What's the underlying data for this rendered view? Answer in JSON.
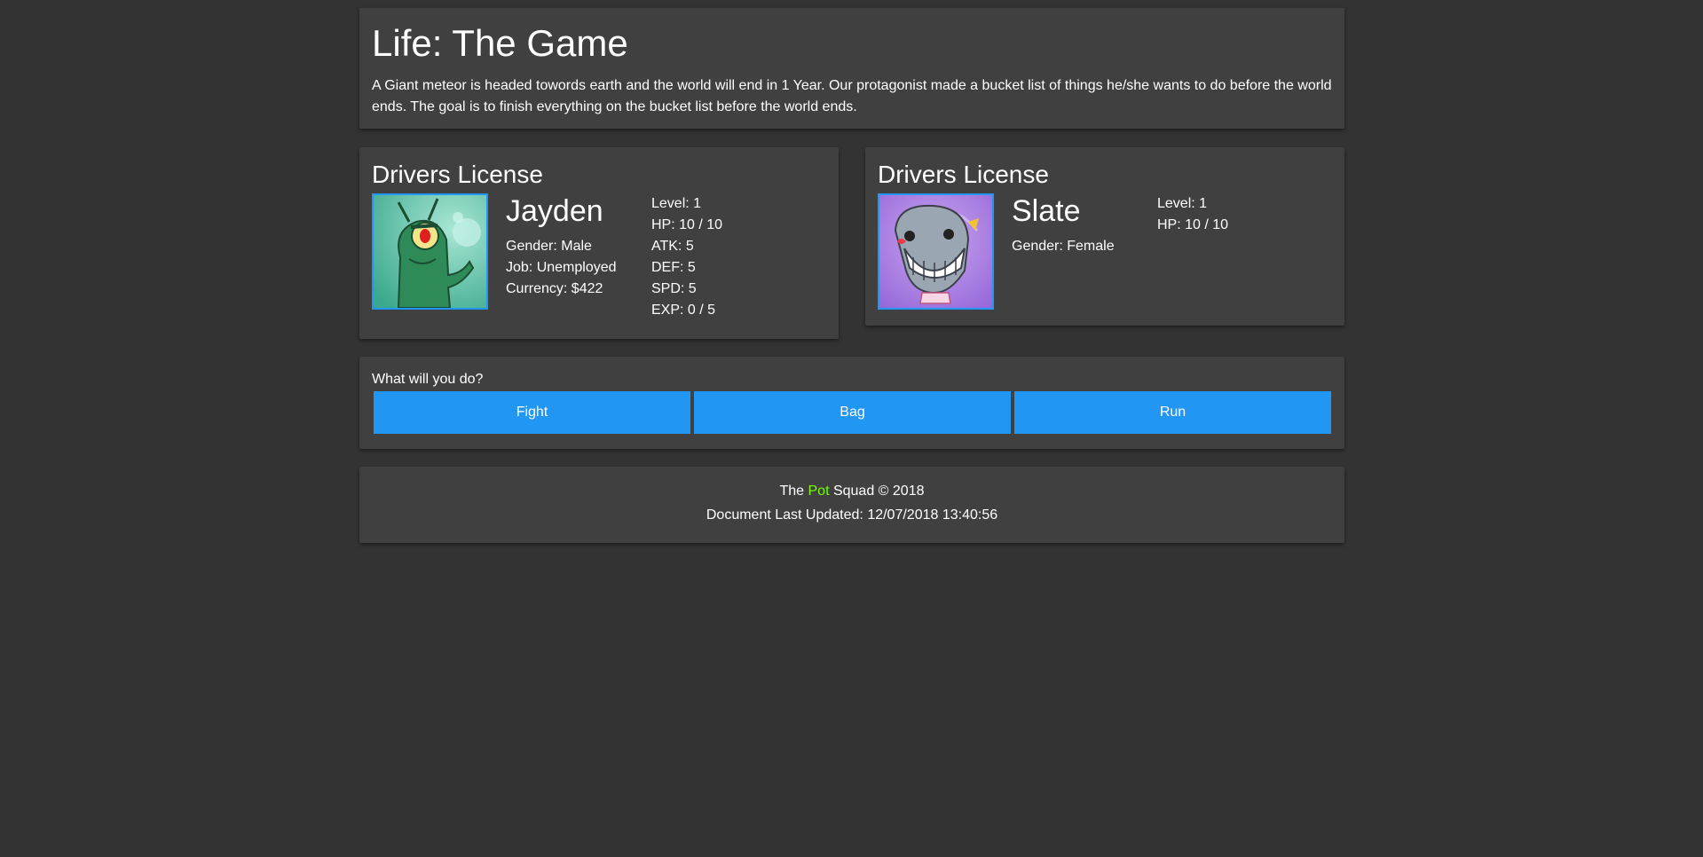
{
  "header": {
    "title": "Life: The Game",
    "description": "A Giant meteor is headed towords earth and the world will end in 1 Year. Our protagonist made a bucket list of things he/she wants to do before the world ends. The goal is to finish everything on the bucket list before the world ends."
  },
  "player": {
    "card_title": "Drivers License",
    "avatar_icon": "plankton-portrait",
    "name": "Jayden",
    "gender": "Gender: Male",
    "job": "Job: Unemployed",
    "currency": "Currency: $422",
    "stats": [
      "Level: 1",
      "HP: 10 / 10",
      "ATK: 5",
      "DEF: 5",
      "SPD: 5",
      "EXP: 0 / 5"
    ]
  },
  "opponent": {
    "card_title": "Drivers License",
    "avatar_icon": "pearl-whale-portrait",
    "name": "Slate",
    "gender": "Gender: Female",
    "stats": [
      "Level: 1",
      "HP: 10 / 10"
    ]
  },
  "actions": {
    "prompt": "What will you do?",
    "buttons": [
      "Fight",
      "Bag",
      "Run"
    ]
  },
  "footer": {
    "brand_prefix": "The ",
    "brand_accent": "Pot",
    "brand_suffix": " Squad © 2018",
    "updated": "Document Last Updated: 12/07/2018 13:40:56"
  },
  "colors": {
    "background": "#333333",
    "card": "#404040",
    "accent_blue": "#2196f3",
    "accent_green": "#76ff03"
  }
}
